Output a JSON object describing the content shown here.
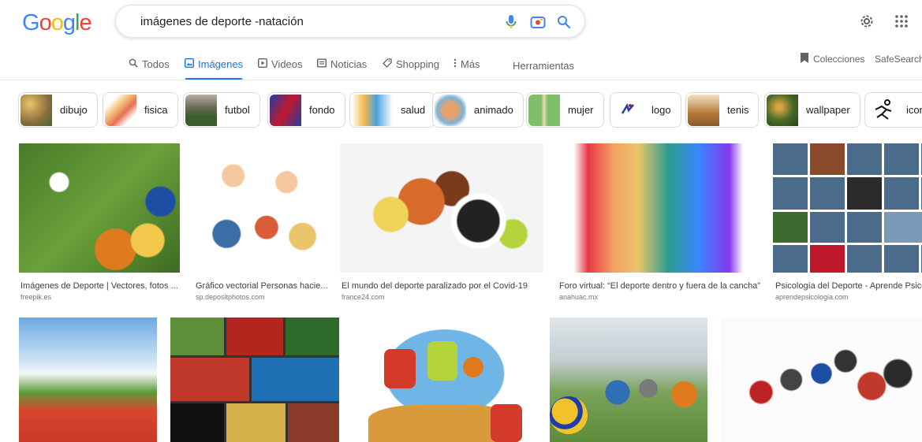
{
  "logo": {
    "text": "Google"
  },
  "search": {
    "query": "imágenes de deporte -natación"
  },
  "tabs": [
    {
      "label": "Todos",
      "icon": "search-icon"
    },
    {
      "label": "Imágenes",
      "icon": "image-icon"
    },
    {
      "label": "Videos",
      "icon": "video-icon"
    },
    {
      "label": "Noticias",
      "icon": "news-icon"
    },
    {
      "label": "Shopping",
      "icon": "tag-icon"
    },
    {
      "label": "Más",
      "icon": "more-vert-icon"
    },
    {
      "label": "Herramientas"
    }
  ],
  "topright": {
    "collections": "Colecciones",
    "safesearch": "SafeSearch"
  },
  "chips": [
    {
      "label": "dibujo",
      "color": "#8a6b3c"
    },
    {
      "label": "fisica",
      "color": "#f1c27d"
    },
    {
      "label": "futbol",
      "color": "#3b5f2a"
    },
    {
      "label": "fondo",
      "color": "#1f3ea8"
    },
    {
      "label": "salud",
      "color": "#f6b84a"
    },
    {
      "label": "animado",
      "color": "#e8a06b"
    },
    {
      "label": "mujer",
      "color": "#7fbf6a"
    },
    {
      "label": "logo",
      "color": "#ffffff"
    },
    {
      "label": "tenis",
      "color": "#b57a3c"
    },
    {
      "label": "wallpaper",
      "color": "#4b6b2a"
    },
    {
      "label": "icon",
      "color": "#ffffff"
    }
  ],
  "results_row1": [
    {
      "caption": "Imágenes de Deporte | Vectores, fotos ...",
      "source": "freepik.es"
    },
    {
      "caption": "Gráfico vectorial Personas hacie...",
      "source": "sp.depositphotos.com"
    },
    {
      "caption": "El mundo del deporte paralizado por el Covid-19",
      "source": "france24.com"
    },
    {
      "caption": "Foro virtual: “El deporte dentro y fuera de la cancha”",
      "source": "anahuac.mx"
    },
    {
      "caption": "Psicología del Deporte - Aprende Psicología",
      "source": "aprendepsicologia.com"
    }
  ]
}
